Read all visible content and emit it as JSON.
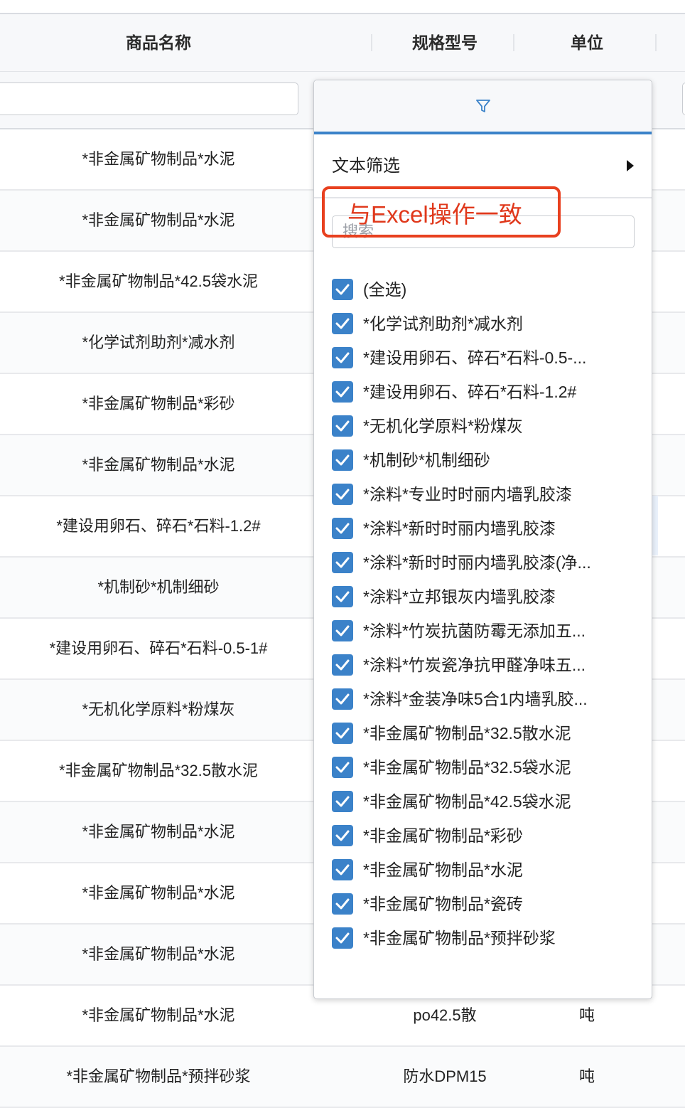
{
  "table": {
    "headers": {
      "name": "商品名称",
      "spec": "规格型号",
      "unit": "单位"
    },
    "rows": [
      {
        "name": "*非金属矿物制品*水泥",
        "spec": "",
        "unit": ""
      },
      {
        "name": "*非金属矿物制品*水泥",
        "spec": "",
        "unit": ""
      },
      {
        "name": "*非金属矿物制品*42.5袋水泥",
        "spec": "",
        "unit": ""
      },
      {
        "name": "*化学试剂助剂*减水剂",
        "spec": "",
        "unit": ""
      },
      {
        "name": "*非金属矿物制品*彩砂",
        "spec": "",
        "unit": ""
      },
      {
        "name": "*非金属矿物制品*水泥",
        "spec": "",
        "unit": ""
      },
      {
        "name": "*建设用卵石、碎石*石料-1.2#",
        "spec": "",
        "unit": ""
      },
      {
        "name": "*机制砂*机制细砂",
        "spec": "",
        "unit": ""
      },
      {
        "name": "*建设用卵石、碎石*石料-0.5-1#",
        "spec": "",
        "unit": ""
      },
      {
        "name": "*无机化学原料*粉煤灰",
        "spec": "",
        "unit": ""
      },
      {
        "name": "*非金属矿物制品*32.5散水泥",
        "spec": "",
        "unit": ""
      },
      {
        "name": "*非金属矿物制品*水泥",
        "spec": "",
        "unit": ""
      },
      {
        "name": "*非金属矿物制品*水泥",
        "spec": "",
        "unit": ""
      },
      {
        "name": "*非金属矿物制品*水泥",
        "spec": "",
        "unit": ""
      },
      {
        "name": "*非金属矿物制品*水泥",
        "spec": "po42.5散",
        "unit": "吨"
      },
      {
        "name": "*非金属矿物制品*预拌砂浆",
        "spec": "防水DPM15",
        "unit": "吨"
      }
    ]
  },
  "filter_popup": {
    "icon": "funnel-icon",
    "menu_text_filter": "文本筛选",
    "search_placeholder": "搜索",
    "items": [
      "(全选)",
      "*化学试剂助剂*减水剂",
      "*建设用卵石、碎石*石料-0.5-...",
      "*建设用卵石、碎石*石料-1.2#",
      "*无机化学原料*粉煤灰",
      "*机制砂*机制细砂",
      "*涂料*专业时时丽内墙乳胶漆",
      "*涂料*新时时丽内墙乳胶漆",
      "*涂料*新时时丽内墙乳胶漆(净...",
      "*涂料*立邦银灰内墙乳胶漆",
      "*涂料*竹炭抗菌防霉无添加五...",
      "*涂料*竹炭瓷净抗甲醛净味五...",
      "*涂料*金装净味5合1内墙乳胶...",
      "*非金属矿物制品*32.5散水泥",
      "*非金属矿物制品*32.5袋水泥",
      "*非金属矿物制品*42.5袋水泥",
      "*非金属矿物制品*彩砂",
      "*非金属矿物制品*水泥",
      "*非金属矿物制品*瓷砖",
      "*非金属矿物制品*预拌砂浆"
    ],
    "all_checked": true
  },
  "annotation": {
    "text": "与Excel操作一致"
  },
  "colors": {
    "accent": "#3b82c9",
    "annotation": "#e8401f",
    "header_bg": "#f7f8fa"
  }
}
